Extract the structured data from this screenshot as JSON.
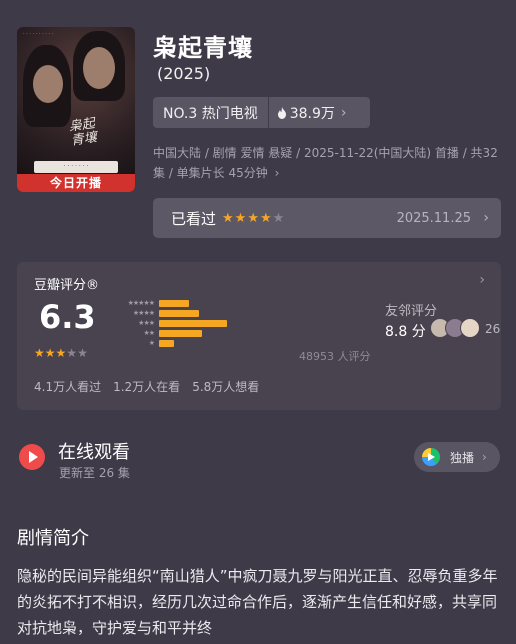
{
  "poster": {
    "banner": "今日开播"
  },
  "header": {
    "title": "枭起青壤",
    "year": "(2025)",
    "rank": "NO.3 热门电视",
    "heat": "38.9万",
    "meta": "中国大陆 / 剧情 爱情 悬疑 / 2025-11-22(中国大陆) 首播 / 共32集 / 单集片长 45分钟"
  },
  "watched": {
    "label": "已看过",
    "stars": 4,
    "date": "2025.11.25"
  },
  "rating": {
    "header": "豆瓣评分®",
    "score": "6.3",
    "stars": 3,
    "distribution": [
      {
        "stars": 5,
        "fraction": 0.12
      },
      {
        "stars": 4,
        "fraction": 0.16
      },
      {
        "stars": 3,
        "fraction": 0.27
      },
      {
        "stars": 2,
        "fraction": 0.17
      },
      {
        "stars": 1,
        "fraction": 0.06
      }
    ],
    "ratings_count": "48953 人评分",
    "friends_label": "友邻评分",
    "friends_score": "8.8 分",
    "friends_count": "26",
    "stats": [
      "4.1万人看过",
      "1.2万人在看",
      "5.8万人想看"
    ]
  },
  "watch": {
    "title": "在线观看",
    "subtitle": "更新至 26 集",
    "platform_label": "独播"
  },
  "synopsis": {
    "title": "剧情简介",
    "text": "隐秘的民间异能组织“南山猎人”中疯刀聂九罗与阳光正直、忍辱负重多年的炎拓不打不相识，经历几次过命合作后，逐渐产生信任和好感，共享同对抗地枭，守护爱与和平并终"
  },
  "colors": {
    "background": "#3f3a47",
    "accent_star": "#f5a623",
    "play_red": "#ef4b4b",
    "banner_red": "#d2322e"
  }
}
